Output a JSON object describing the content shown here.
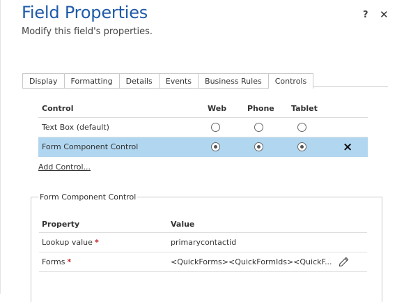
{
  "dialog": {
    "title": "Field Properties",
    "subtitle": "Modify this field's properties.",
    "help_label": "?",
    "close_label": "✕"
  },
  "tabs": [
    {
      "label": "Display"
    },
    {
      "label": "Formatting"
    },
    {
      "label": "Details"
    },
    {
      "label": "Events"
    },
    {
      "label": "Business Rules"
    },
    {
      "label": "Controls",
      "active": true
    }
  ],
  "controls_table": {
    "headers": {
      "control": "Control",
      "web": "Web",
      "phone": "Phone",
      "tablet": "Tablet"
    },
    "rows": [
      {
        "name": "Text Box (default)",
        "web": false,
        "phone": false,
        "tablet": false,
        "selected": false
      },
      {
        "name": "Form Component Control",
        "web": true,
        "phone": true,
        "tablet": true,
        "selected": true,
        "remove_icon": "×"
      }
    ],
    "add_control_label": "Add Control..."
  },
  "component_section": {
    "legend": "Form Component Control",
    "headers": {
      "property": "Property",
      "value": "Value"
    },
    "rows": [
      {
        "property": "Lookup value",
        "required_mark": "*",
        "value": "primarycontactid",
        "editable": false
      },
      {
        "property": "Forms",
        "required_mark": "*",
        "value": "<QuickForms><QuickFormIds><QuickF...",
        "editable": true
      }
    ]
  },
  "colors": {
    "title": "#1f5ba8",
    "selected_row": "#b1d6f0",
    "required": "#c0262d"
  }
}
